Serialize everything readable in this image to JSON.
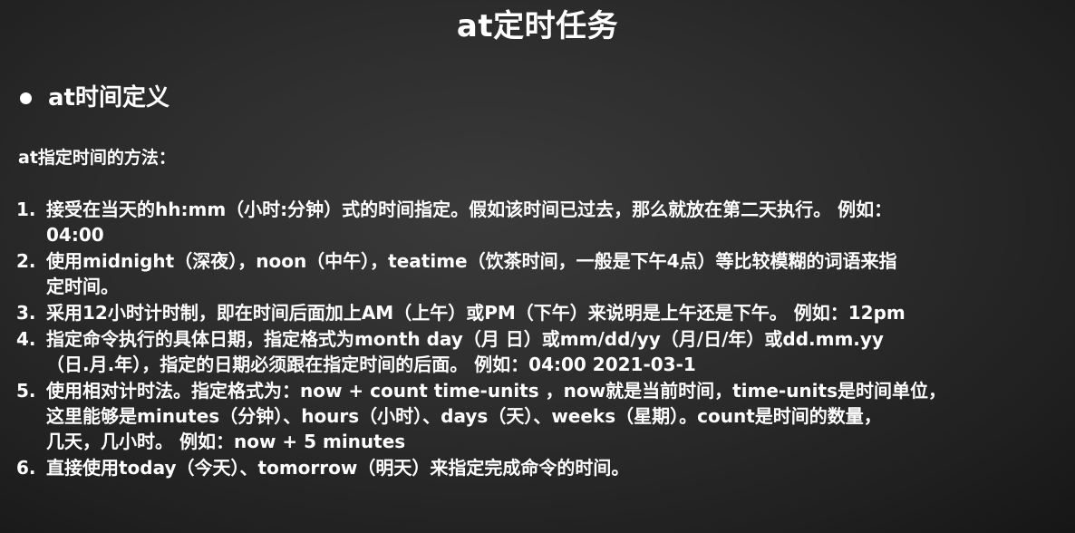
{
  "title": "at定时任务",
  "heading": "at时间定义",
  "intro": "at指定时间的方法：",
  "items": [
    {
      "num": "1.",
      "lines": [
        "接受在当天的hh:mm（小时:分钟）式的时间指定。假如该时间已过去，那么就放在第二天执行。 例如：",
        "04:00"
      ]
    },
    {
      "num": "2.",
      "lines": [
        "使用midnight（深夜），noon（中午），teatime（饮茶时间，一般是下午4点）等比较模糊的词语来指",
        "定时间。"
      ]
    },
    {
      "num": "3.",
      "lines": [
        "采用12小时计时制，即在时间后面加上AM（上午）或PM（下午）来说明是上午还是下午。 例如：12pm"
      ]
    },
    {
      "num": "4.",
      "lines": [
        "指定命令执行的具体日期，指定格式为month day（月 日）或mm/dd/yy（月/日/年）或dd.mm.yy",
        "（日.月.年），指定的日期必须跟在指定时间的后面。 例如：04:00 2021-03-1"
      ]
    },
    {
      "num": "5.",
      "lines": [
        "使用相对计时法。指定格式为：now + count time-units ，now就是当前时间，time-units是时间单位，",
        "这里能够是minutes（分钟）、hours（小时）、days（天）、weeks（星期）。count是时间的数量，",
        "几天，几小时。 例如：now + 5 minutes"
      ]
    },
    {
      "num": "6.",
      "lines": [
        "直接使用today（今天）、tomorrow（明天）来指定完成命令的时间。"
      ]
    }
  ]
}
